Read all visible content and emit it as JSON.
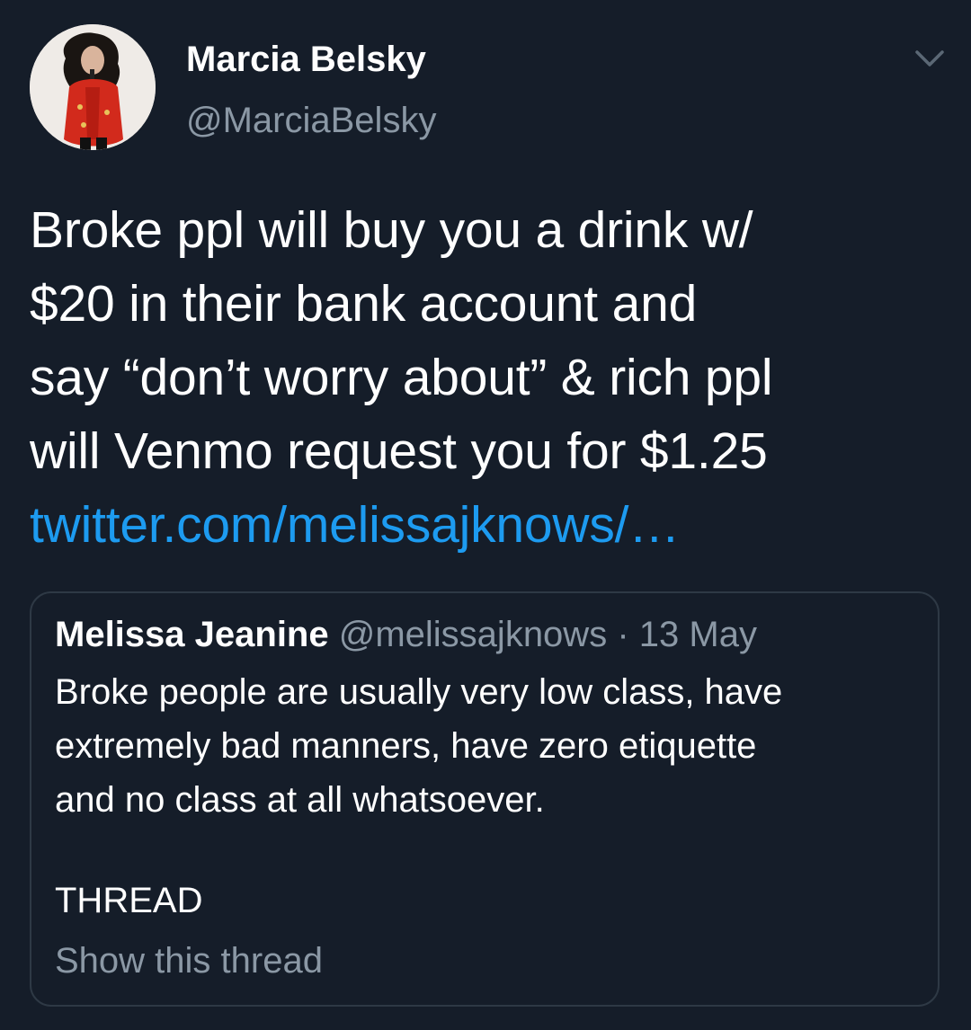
{
  "tweet": {
    "author": {
      "name": "Marcia Belsky",
      "handle": "@MarciaBelsky"
    },
    "text_lines": [
      "Broke ppl will buy you a drink w/",
      "$20 in their bank account and",
      "say “don’t worry about” & rich ppl",
      "will Venmo request you for $1.25"
    ],
    "link": "twitter.com/melissajknows/…",
    "menu_icon": "chevron-down-icon"
  },
  "quote": {
    "name": "Melissa Jeanine",
    "handle": "@melissajknows",
    "separator": "·",
    "date": "13 May",
    "text_lines": [
      "Broke people are usually very low class, have",
      "extremely bad manners, have zero etiquette",
      "and no class at all whatsoever."
    ],
    "thread_label": "THREAD",
    "show_thread": "Show this thread"
  },
  "colors": {
    "background": "#151d29",
    "text": "#ffffff",
    "secondary_text": "#8b98a5",
    "link": "#1d9bf0",
    "border": "#2e3945"
  }
}
